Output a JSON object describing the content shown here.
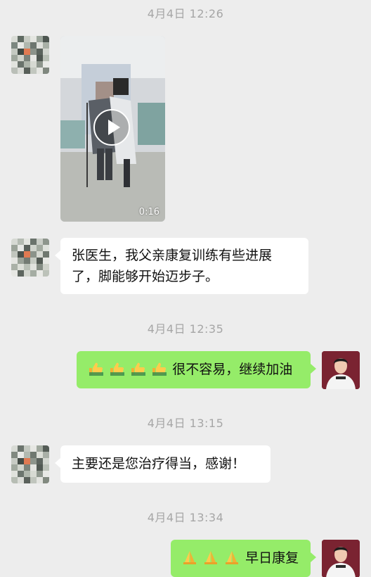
{
  "colors": {
    "background": "#ededed",
    "bubble_self": "#95ec69",
    "bubble_other": "#ffffff",
    "timestamp": "#a6a6a6"
  },
  "messages": {
    "ts1": "4月4日 12:26",
    "video_duration": "0:16",
    "msg1_line1": "张医生，我父亲康复训练有些进展",
    "msg1_line2": "了，脚能够开始迈步子。",
    "ts2": "4月4日 12:35",
    "msg2_text": "很不容易，继续加油",
    "ts3": "4月4日 13:15",
    "msg3_text": "主要还是您治疗得当，感谢！",
    "ts4": "4月4日 13:34",
    "msg4_text": "早日康复"
  },
  "icons": {
    "play": "play-icon",
    "thumbs_up": "thumbs-up-emoji",
    "pray": "folded-hands-emoji"
  }
}
